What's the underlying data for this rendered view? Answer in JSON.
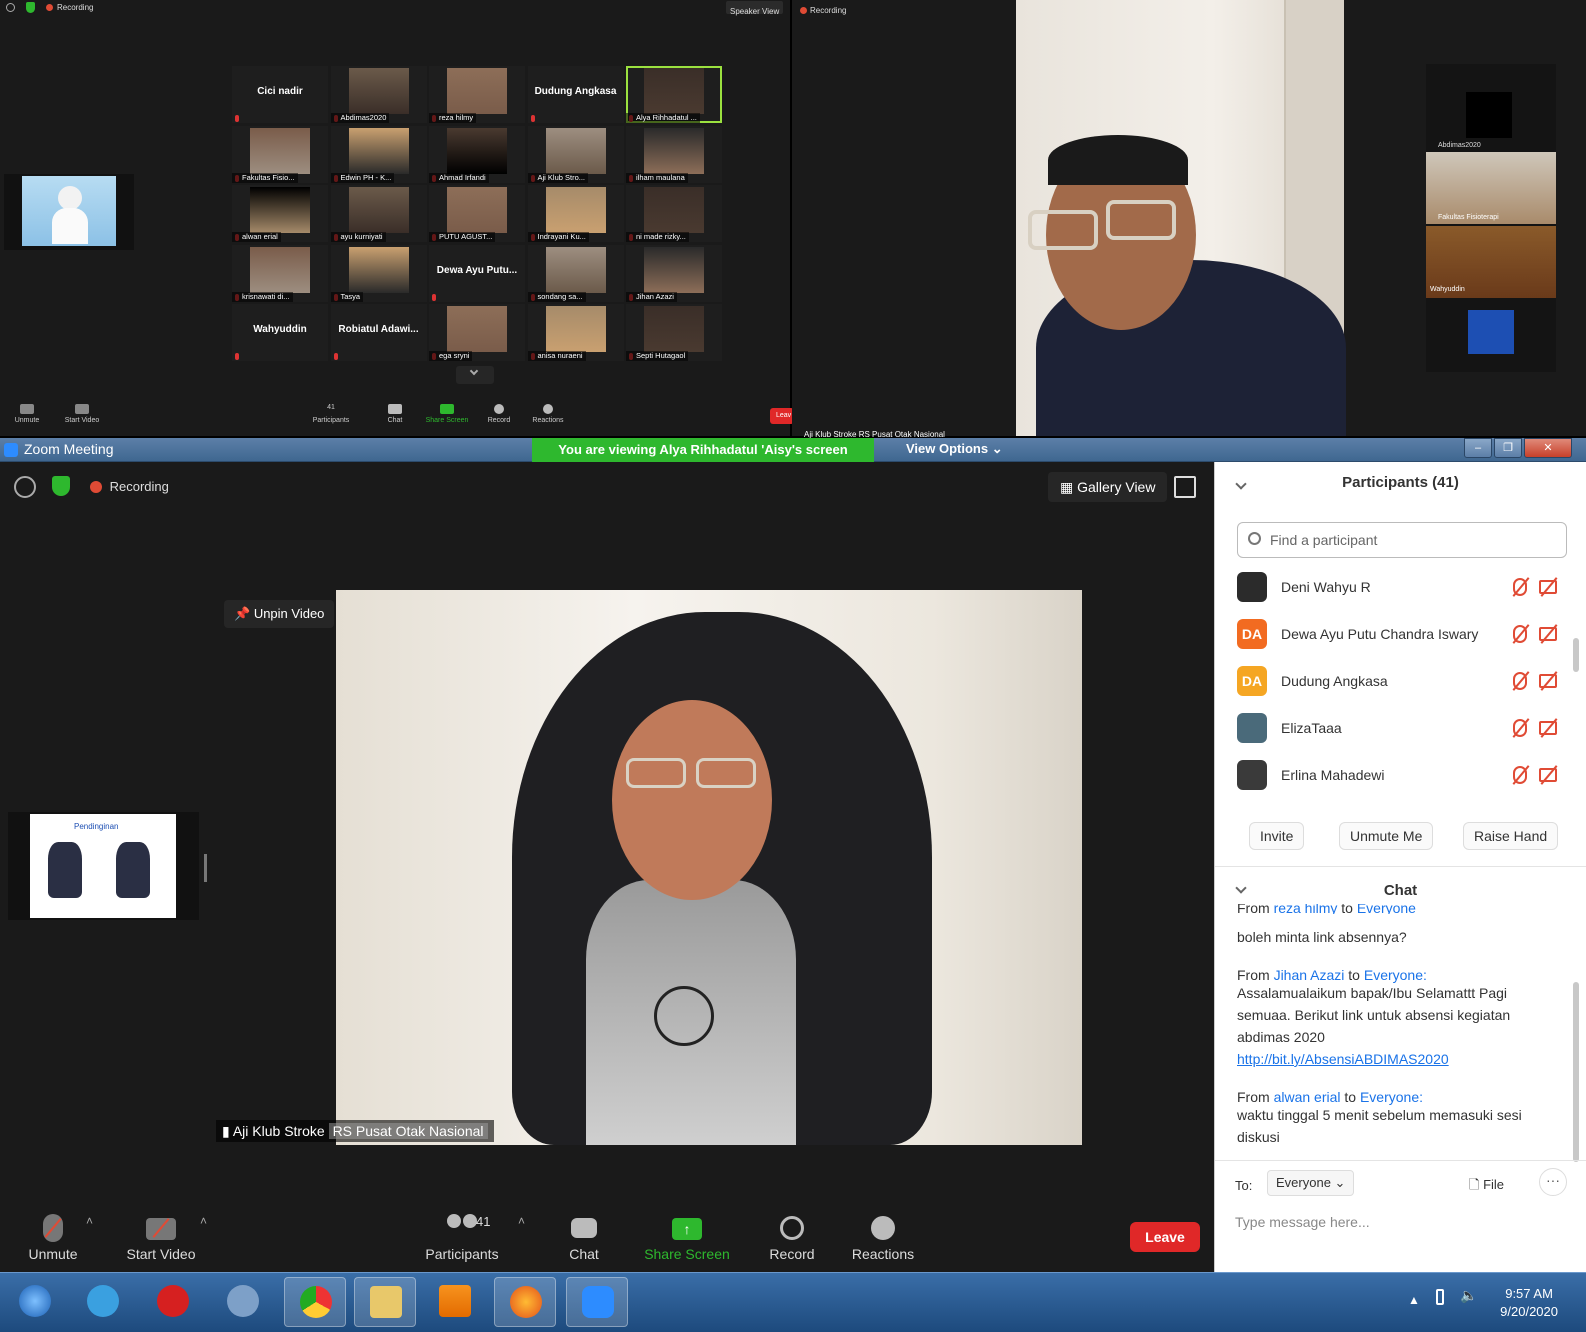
{
  "top_left": {
    "status": {
      "recording": "Recording",
      "view": "Speaker View"
    },
    "tiles": [
      {
        "name": "Cici nadir",
        "big": true
      },
      {
        "name": "Abdimas2020",
        "big": false
      },
      {
        "name": "reza hilmy",
        "big": false
      },
      {
        "name": "Dudung Angkasa",
        "big": true
      },
      {
        "name": "Alya Rihhadatul ...",
        "big": false,
        "active": true
      },
      {
        "name": "Fakultas Fisio...",
        "big": false
      },
      {
        "name": "Edwin PH - K...",
        "big": false
      },
      {
        "name": "Ahmad Irfandi",
        "big": false
      },
      {
        "name": "Aji Klub Stro...",
        "big": false
      },
      {
        "name": "ilham maulana",
        "big": false
      },
      {
        "name": "alwan erial",
        "big": false
      },
      {
        "name": "ayu kurniyati",
        "big": false
      },
      {
        "name": "PUTU AGUST...",
        "big": false
      },
      {
        "name": "Indrayani Ku...",
        "big": false
      },
      {
        "name": "ni made rizky...",
        "big": false
      },
      {
        "name": "krisnawati di...",
        "big": false
      },
      {
        "name": "Tasya",
        "big": false
      },
      {
        "name": "Dewa Ayu Putu...",
        "big": true
      },
      {
        "name": "sondang sa...",
        "big": false
      },
      {
        "name": "Jihan Azazi",
        "big": false
      },
      {
        "name": "Wahyuddin",
        "big": true
      },
      {
        "name": "Robiatul Adawi...",
        "big": true
      },
      {
        "name": "ega sryni",
        "big": false
      },
      {
        "name": "anisa nuraeni",
        "big": false
      },
      {
        "name": "Septi Hutagaol",
        "big": false
      }
    ],
    "toolbar": {
      "unmute": "Unmute",
      "start_video": "Start Video",
      "participants_count": "41",
      "participants": "Participants",
      "chat": "Chat",
      "share": "Share Screen",
      "record": "Record",
      "reactions": "Reactions",
      "leave": "Leav"
    }
  },
  "top_right": {
    "recording": "Recording",
    "speaker_label": "Aji Klub Stroke RS Pusat Otak Nasional",
    "side_tiles": [
      "Abdimas2020",
      "Fakultas Fisioterapi",
      "Wahyuddin"
    ]
  },
  "window": {
    "title": "Zoom Meeting",
    "share_banner": "You are viewing Alya Rihhadatul 'Aisy's screen",
    "view_options": "View Options",
    "recording": "Recording",
    "gallery_view": "Gallery View",
    "unpin": "Unpin Video",
    "video_label_a": "Aji Klub Stroke",
    "video_label_b": "RS Pusat Otak Nasional",
    "slide_title": "Pendinginan",
    "toolbar": {
      "unmute": "Unmute",
      "start_video": "Start Video",
      "participants_count": "41",
      "participants": "Participants",
      "chat": "Chat",
      "share": "Share Screen",
      "record": "Record",
      "reactions": "Reactions",
      "leave": "Leave"
    }
  },
  "participants_panel": {
    "title": "Participants (41)",
    "search_placeholder": "Find a participant",
    "rows": [
      {
        "name": "Deni Wahyu R",
        "initials": "",
        "color": "#2b2b2b"
      },
      {
        "name": "Dewa Ayu Putu Chandra Iswary",
        "initials": "DA",
        "color": "#f26b21"
      },
      {
        "name": "Dudung Angkasa",
        "initials": "DA",
        "color": "#f5a623"
      },
      {
        "name": "ElizaTaaa",
        "initials": "",
        "color": "#4a6a7a"
      },
      {
        "name": "Erlina Mahadewi",
        "initials": "",
        "color": "#3a3a3a"
      }
    ],
    "buttons": {
      "invite": "Invite",
      "unmute_me": "Unmute Me",
      "raise_hand": "Raise Hand"
    }
  },
  "chat": {
    "title": "Chat",
    "messages": [
      {
        "from_prefix": "From",
        "sender": "reza hilmy",
        "to": "to",
        "recipient": "Everyone",
        "text": "boleh minta link absennya?"
      },
      {
        "from_prefix": "From",
        "sender": "Jihan Azazi",
        "to": "to",
        "recipient": "Everyone:",
        "text": "Assalamualaikum bapak/Ibu Selamattt Pagi semuaa. Berikut link untuk absensi kegiatan abdimas 2020",
        "link": "http://bit.ly/AbsensiABDIMAS2020"
      },
      {
        "from_prefix": "From",
        "sender": "alwan erial",
        "to": "to",
        "recipient": "Everyone:",
        "text": "waktu tinggal 5 menit sebelum memasuki sesi diskusi"
      }
    ],
    "to_label": "To:",
    "to_value": "Everyone",
    "file": "File",
    "more": "···",
    "placeholder": "Type message here..."
  },
  "taskbar": {
    "time": "9:57 AM",
    "date": "9/20/2020"
  },
  "colors": {
    "accent": "#2d8cff",
    "leave": "#e02828",
    "share": "#2eb82e",
    "muted": "#e04b35"
  }
}
